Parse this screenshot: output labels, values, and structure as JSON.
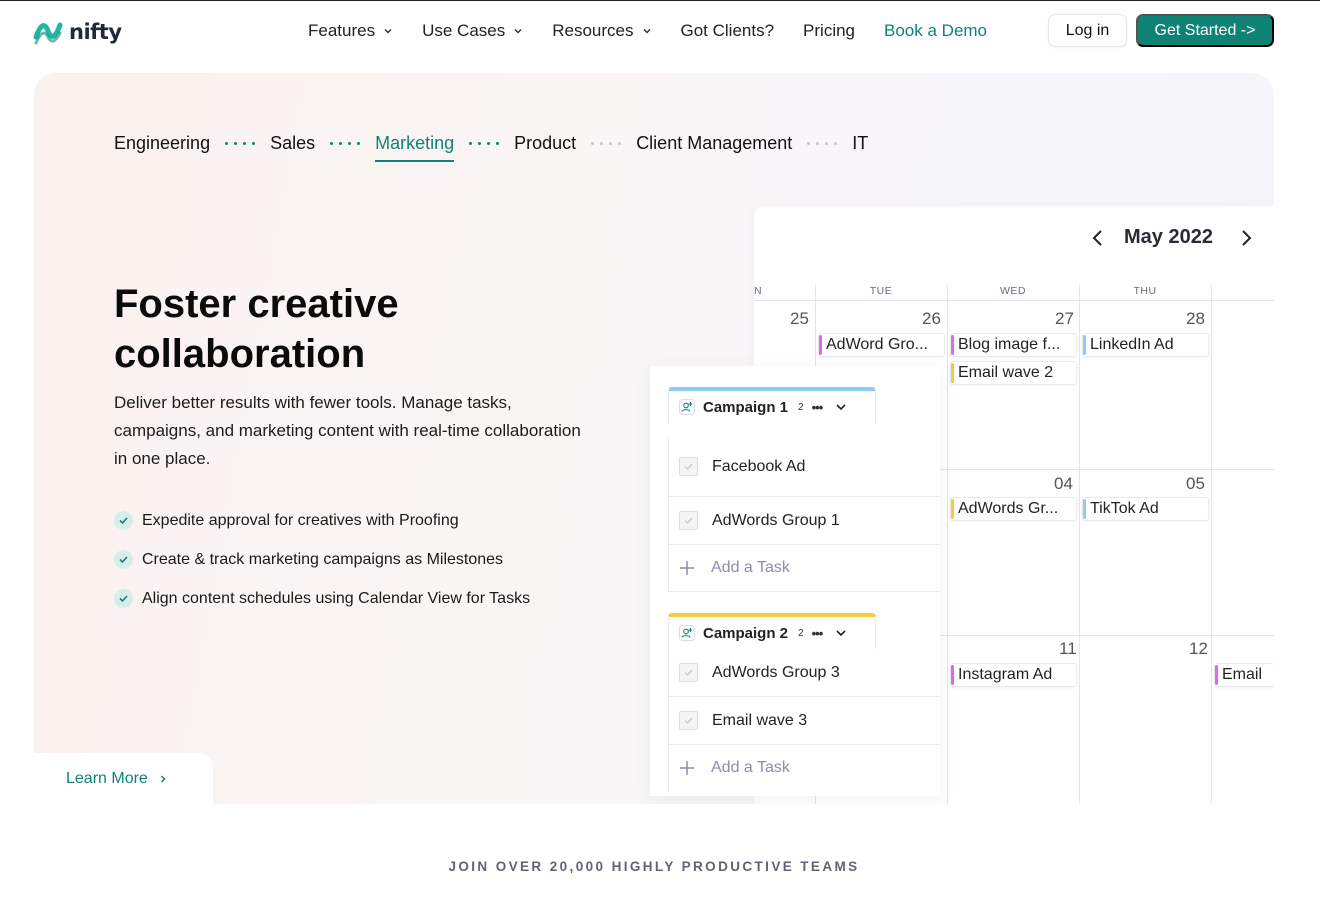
{
  "brand": {
    "name": "nifty",
    "accent": "#0e8375"
  },
  "nav": {
    "items": [
      {
        "label": "Features",
        "dropdown": true
      },
      {
        "label": "Use Cases",
        "dropdown": true
      },
      {
        "label": "Resources",
        "dropdown": true
      },
      {
        "label": "Got Clients?",
        "dropdown": false
      },
      {
        "label": "Pricing",
        "dropdown": false
      },
      {
        "label": "Book a Demo",
        "dropdown": false
      }
    ],
    "login": "Log in",
    "get_started": "Get Started ->"
  },
  "tabs": [
    "Engineering",
    "Sales",
    "Marketing",
    "Product",
    "Client Management",
    "IT"
  ],
  "active_tab": "Marketing",
  "hero": {
    "headline": "Foster creative collaboration",
    "subtext": "Deliver better results with fewer tools. Manage tasks, campaigns, and marketing content with real-time collaboration in one place.",
    "bullets": [
      "Expedite approval for creatives with Proofing",
      "Create & track marketing campaigns as Milestones",
      "Align content schedules using Calendar View for Tasks"
    ],
    "learn_more": "Learn More"
  },
  "calendar": {
    "month": "May 2022",
    "day_names": [
      "N",
      "TUE",
      "WED",
      "THU"
    ],
    "dates": {
      "row1": [
        "25",
        "26",
        "27",
        "28"
      ],
      "row2": [
        "04",
        "05"
      ],
      "row3": [
        "11",
        "12"
      ]
    },
    "events": {
      "adword_gro": {
        "label": "AdWord Gro...",
        "color": "#d66cf2"
      },
      "blog_image": {
        "label": "Blog image f...",
        "color": "#d66cf2"
      },
      "linkedin": {
        "label": "LinkedIn Ad",
        "color": "#8ccdf5"
      },
      "email_wave_2": {
        "label": "Email wave 2",
        "color": "#f5cc3a"
      },
      "adwords_gr": {
        "label": "AdWords Gr...",
        "color": "#f5cc3a"
      },
      "tiktok": {
        "label": "TikTok Ad",
        "color": "#8ccdf5"
      },
      "instagram": {
        "label": "Instagram Ad",
        "color": "#d66cf2"
      },
      "email": {
        "label": "Email",
        "color": "#d66cf2"
      }
    }
  },
  "campaigns": [
    {
      "name": "Campaign 1",
      "count": "2",
      "color": "#8ccdf5",
      "tasks": [
        "Facebook Ad",
        "AdWords Group 1"
      ],
      "add": "Add a Task"
    },
    {
      "name": "Campaign 2",
      "count": "2",
      "color": "#f5cc3a",
      "tasks": [
        "AdWords Group 3",
        "Email wave 3"
      ],
      "add": "Add a Task"
    }
  ],
  "footer": {
    "teams": "JOIN OVER 20,000 HIGHLY PRODUCTIVE TEAMS"
  }
}
